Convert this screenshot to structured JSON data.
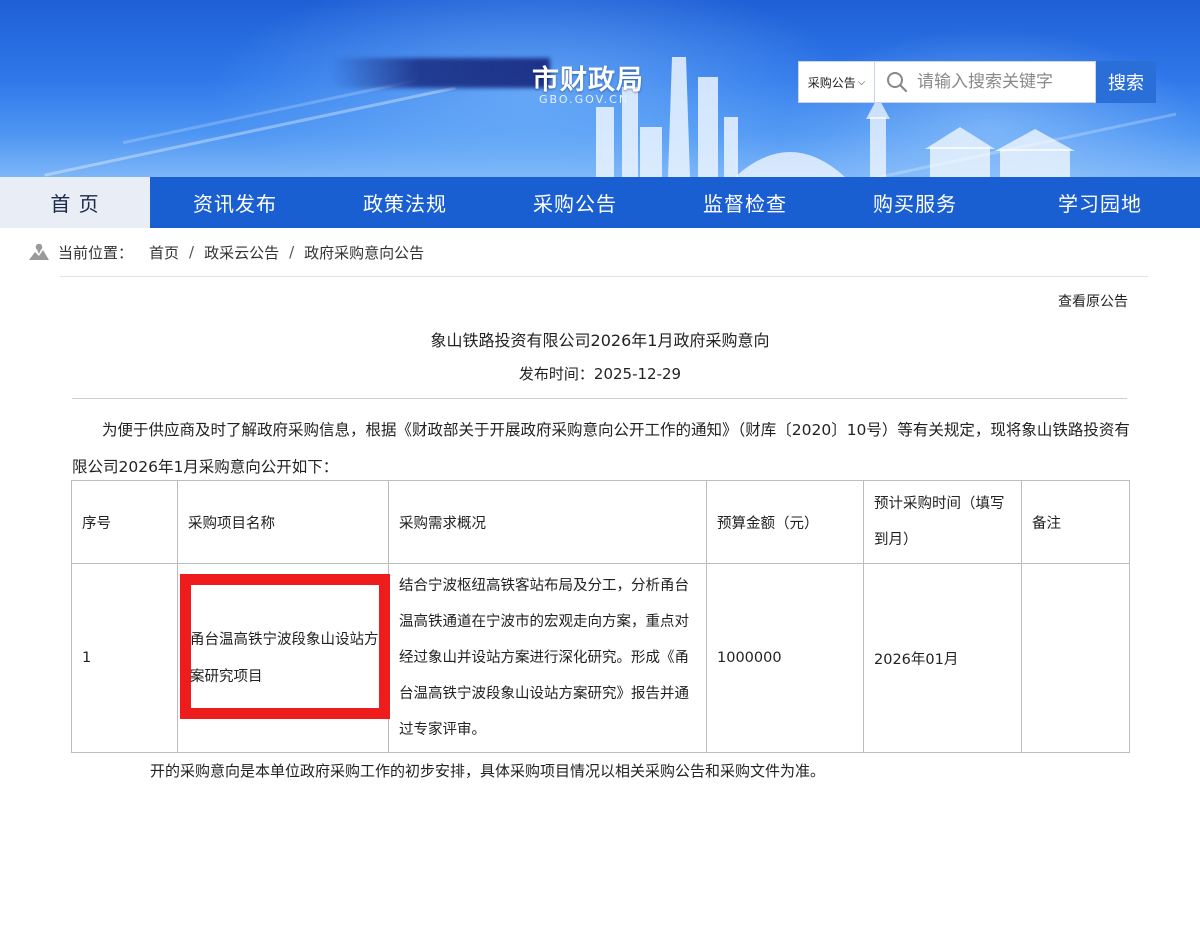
{
  "header": {
    "site_title": "市财政局",
    "site_domain": "GBO.GOV.CN",
    "search": {
      "category_selected": "采购公告",
      "placeholder": "请输入搜索关键字",
      "button_label": "搜索"
    }
  },
  "nav": {
    "items": [
      {
        "label": "首 页",
        "active": true
      },
      {
        "label": "资讯发布",
        "active": false
      },
      {
        "label": "政策法规",
        "active": false
      },
      {
        "label": "采购公告",
        "active": false
      },
      {
        "label": "监督检查",
        "active": false
      },
      {
        "label": "购买服务",
        "active": false
      },
      {
        "label": "学习园地",
        "active": false
      }
    ]
  },
  "breadcrumb": {
    "prefix": "当前位置：",
    "items": [
      "首页",
      "政采云公告",
      "政府采购意向公告"
    ],
    "separator": "/"
  },
  "article": {
    "view_original": "查看原公告",
    "title": "象山铁路投资有限公司2026年1月政府采购意向",
    "publish_time": "发布时间：2025-12-29",
    "intro": "为便于供应商及时了解政府采购信息，根据《财政部关于开展政府采购意向公开工作的通知》（财库〔2020〕10号）等有关规定，现将象山铁路投资有限公司2026年1月采购意向公开如下：",
    "table": {
      "headers": [
        "序号",
        "采购项目名称",
        "采购需求概况",
        "预算金额（元）",
        "预计采购时间（填写到月）",
        "备注"
      ],
      "rows": [
        {
          "index": "1",
          "project_name": "甬台温高铁宁波段象山设站方案研究项目",
          "requirement": "结合宁波枢纽高铁客站布局及分工，分析甬台温高铁通道在宁波市的宏观走向方案，重点对经过象山并设站方案进行深化研究。形成《甬台温高铁宁波段象山设站方案研究》报告并通过专家评审。",
          "budget": "1000000",
          "expected_time": "2026年01月",
          "remark": ""
        }
      ]
    },
    "footer_note": "开的采购意向是本单位政府采购工作的初步安排，具体采购项目情况以相关采购公告和采购文件为准。"
  },
  "colors": {
    "nav_bg": "#1a5fd2",
    "highlight_box": "#ee1c1c",
    "search_button": "#2a6fd8"
  }
}
